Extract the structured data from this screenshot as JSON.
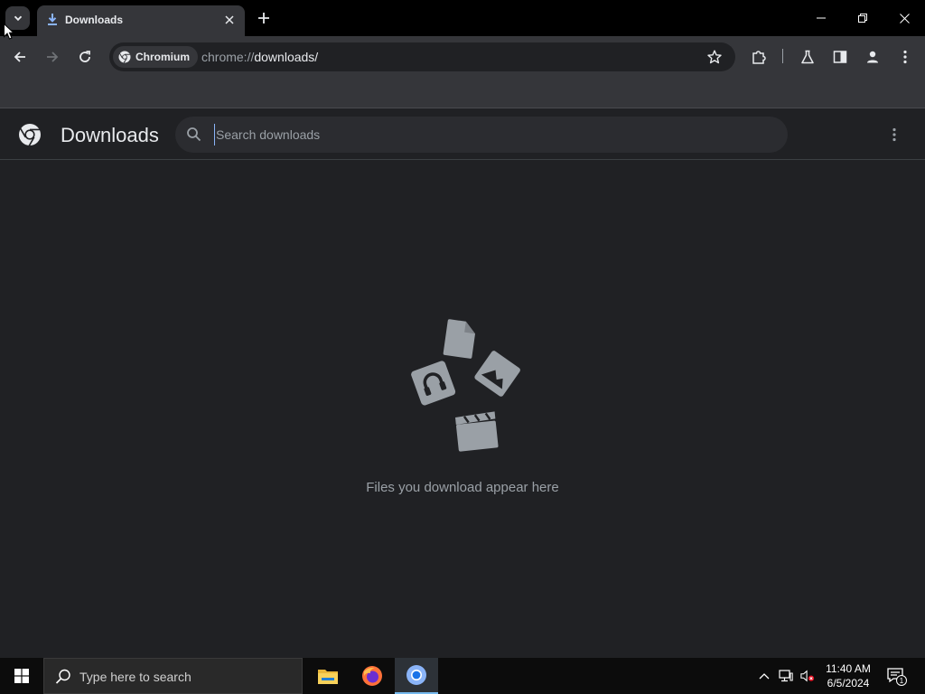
{
  "browser": {
    "tab": {
      "title": "Downloads",
      "favicon": "download-icon"
    },
    "window_controls": [
      "minimize-icon",
      "restore-icon",
      "close-icon"
    ],
    "omnibox": {
      "chip_label": "Chromium",
      "url_scheme": "chrome://",
      "url_path": "downloads/"
    }
  },
  "downloads_page": {
    "title": "Downloads",
    "search_placeholder": "Search downloads",
    "empty_message": "Files you download appear here"
  },
  "taskbar": {
    "search_text": "Type here to search",
    "apps": [
      "file-explorer-icon",
      "firefox-icon",
      "chromium-icon"
    ],
    "clock": {
      "time": "11:40 AM",
      "date": "6/5/2024"
    },
    "notification_count": "1"
  },
  "colors": {
    "tab_strip": "#000000",
    "toolbar": "#35363a",
    "page_bg": "#202124",
    "accent": "#8ab4f8",
    "illustration": "#9aa0a6"
  }
}
